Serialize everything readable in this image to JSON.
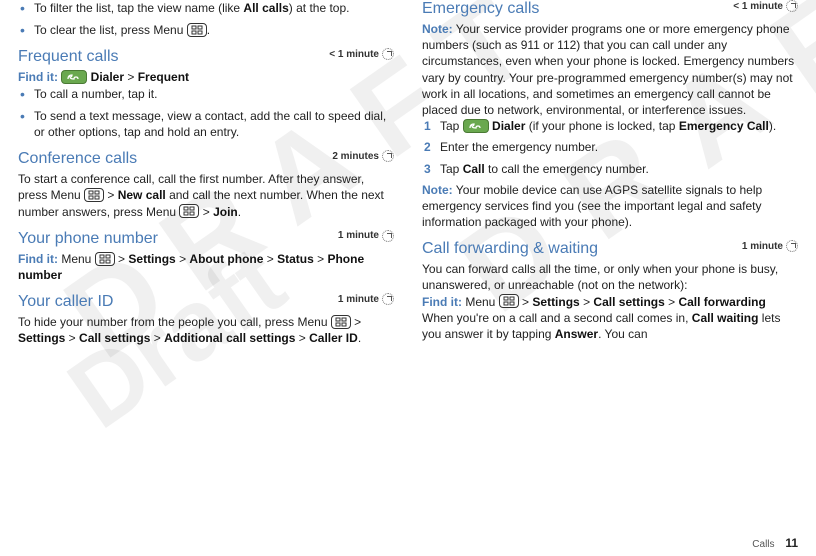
{
  "watermarks": {
    "draft1": "DRAFT",
    "draft2": "DRAFT",
    "draft3": "Draft"
  },
  "times": {
    "lt1": "< 1 minute",
    "m2": "2 minutes",
    "m1": "1 minute"
  },
  "labels": {
    "findit": "Find it:",
    "note": "Note:",
    "menu_word": "Menu",
    "dialer": "Dialer"
  },
  "col1": {
    "intro_bullets": {
      "b1a": "To filter the list, tap the view name (like ",
      "b1b": "All calls",
      "b1c": ") at the top.",
      "b2a": "To clear the list, press Menu ",
      "b2b": "."
    },
    "frequent": {
      "title": "Frequent calls",
      "path_sep": " > ",
      "path_end": "Frequent",
      "b1": "To call a number, tap it.",
      "b2": "To send a text message, view a contact, add the call to speed dial, or other options, tap and hold an entry."
    },
    "conference": {
      "title": "Conference calls",
      "p1a": "To start a conference call, call the first number. After they answer, press Menu ",
      "p1_sep": " > ",
      "p1_newcall": "New call",
      "p1b": " and call the next number. When the next number answers, press Menu ",
      "p1_join": "Join",
      "p1c": "."
    },
    "yourphone": {
      "title": "Your phone number",
      "path": {
        "a": "Settings",
        "b": "About phone",
        "c": "Status",
        "d": "Phone number"
      }
    },
    "callerid": {
      "title": "Your caller ID",
      "p1a": "To hide your number from the people you call, press Menu ",
      "path": {
        "a": "Settings",
        "b": "Call settings",
        "c": "Additional call settings",
        "d": "Caller ID"
      }
    }
  },
  "col2": {
    "emergency": {
      "title": "Emergency calls",
      "note_body": " Your service provider programs one or more emergency phone numbers (such as 911 or 112) that you can call under any circumstances, even when your phone is locked. Emergency numbers vary by country. Your pre-programmed emergency number(s) may not work in all locations, and sometimes an emergency call cannot be placed due to network, environmental, or interference issues.",
      "s1a": "Tap ",
      "s1b": " (if your phone is locked, tap ",
      "s1c": "Emergency Call",
      "s1d": ").",
      "s2": "Enter the emergency number.",
      "s3a": "Tap ",
      "s3b": "Call",
      "s3c": " to call the emergency number.",
      "note2_body": " Your mobile device can use AGPS satellite signals to help emergency services find you (see the important legal and safety information packaged with your phone)."
    },
    "forwarding": {
      "title": "Call forwarding & waiting",
      "p1": "You can forward calls all the time, or only when your phone is busy, unanswered, or unreachable (not on the network):",
      "path": {
        "a": "Settings",
        "b": "Call settings",
        "c": "Call forwarding"
      },
      "p2a": "When you're on a call and a second call comes in, ",
      "p2b": "Call waiting",
      "p2c": " lets you answer it by tapping ",
      "p2d": "Answer",
      "p2e": ". You can"
    }
  },
  "footer": {
    "section": "Calls",
    "page": "11"
  }
}
